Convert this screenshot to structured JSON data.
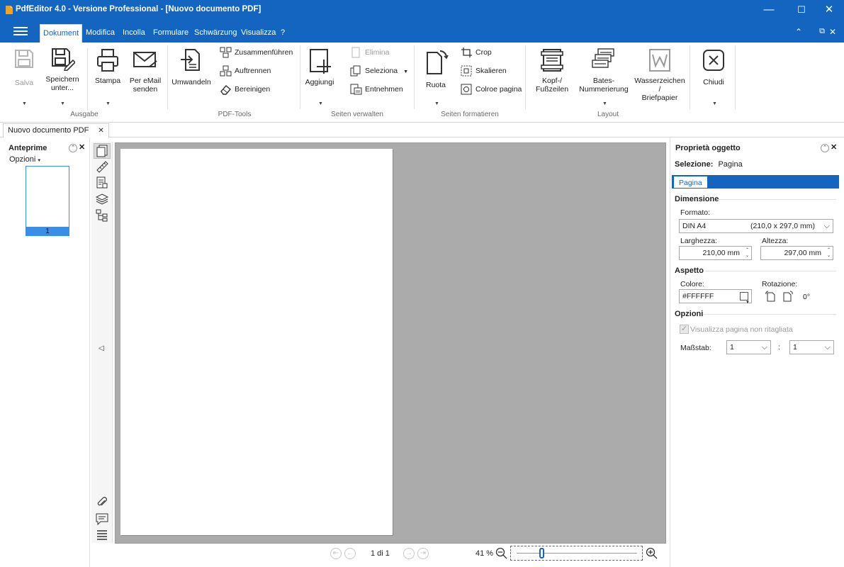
{
  "window": {
    "title": "PdfEditor 4.0 - Versione Professional - [Nuovo documento PDF]",
    "controls": [
      "—",
      "☐",
      "✕"
    ]
  },
  "menu": {
    "tabs": [
      {
        "label": "Dokument",
        "active": true
      },
      {
        "label": "Modifica"
      },
      {
        "label": "Incolla"
      },
      {
        "label": "Formulare"
      },
      {
        "label": "Schwärzung"
      },
      {
        "label": "Visualizza"
      },
      {
        "label": "?"
      }
    ],
    "right_controls": [
      "⌃",
      "⧉",
      "✕"
    ]
  },
  "ribbon": {
    "ausgabe": {
      "label": "Ausgabe",
      "salva": "Salva",
      "speichern_line1": "Speichern",
      "speichern_line2": "unter...",
      "stampa": "Stampa",
      "email_line1": "Per eMail",
      "email_line2": "senden"
    },
    "pdftools": {
      "label": "PDF-Tools",
      "umwandeln": "Umwandeln",
      "zusammenfuehren": "Zusammenführen",
      "auftrennen": "Auftrennen",
      "bereinigen": "Bereinigen"
    },
    "seiten_verwalten": {
      "label": "Seiten verwalten",
      "aggiungi": "Aggiungi",
      "elimina": "Elimina",
      "seleziona": "Seleziona",
      "entnehmen": "Entnehmen"
    },
    "seiten_formatieren": {
      "label": "Seiten formatieren",
      "ruota": "Ruota",
      "crop": "Crop",
      "skalieren": "Skalieren",
      "colore_pagina": "Colroe pagina"
    },
    "layout": {
      "label": "Layout",
      "kopf_line1": "Kopf-/",
      "kopf_line2": "Fußzeilen",
      "bates_line1": "Bates-",
      "bates_line2": "Nummerierung",
      "wasser_line1": "Wasserzeichen /",
      "wasser_line2": "Briefpapier"
    },
    "close": {
      "chiudi": "Chiudi"
    }
  },
  "document_tab": {
    "label": "Nuovo documento PDF",
    "close": "✕"
  },
  "thumbnails": {
    "title": "Anteprime",
    "options": "Opzioni",
    "page_number": "1"
  },
  "statusbar": {
    "page_indicator": "1 di 1",
    "zoom": "41 %"
  },
  "properties": {
    "title": "Proprietà oggetto",
    "selection_label": "Selezione:",
    "selection_value": "Pagina",
    "tab": "Pagina",
    "dimension_section": "Dimensione",
    "format_label": "Formato:",
    "format_value": "DIN A4",
    "format_size": "(210,0 x 297,0 mm)",
    "width_label": "Larghezza:",
    "width_value": "210,00 mm",
    "height_label": "Altezza:",
    "height_value": "297,00 mm",
    "appearance_section": "Aspetto",
    "color_label": "Colore:",
    "color_value": "#FFFFFF",
    "rotation_label": "Rotazione:",
    "rotation_value": "0°",
    "options_section": "Opzioni",
    "show_uncropped_label": "Visualizza pagina non ritagliata",
    "show_uncropped_checked": true,
    "scale_label": "Maßstab:",
    "scale_left": "1",
    "scale_sep": ":",
    "scale_right": "1"
  },
  "colors": {
    "accent": "#1465c0",
    "canvas": "#ababab",
    "thumb_highlight": "#3a8ee6"
  }
}
